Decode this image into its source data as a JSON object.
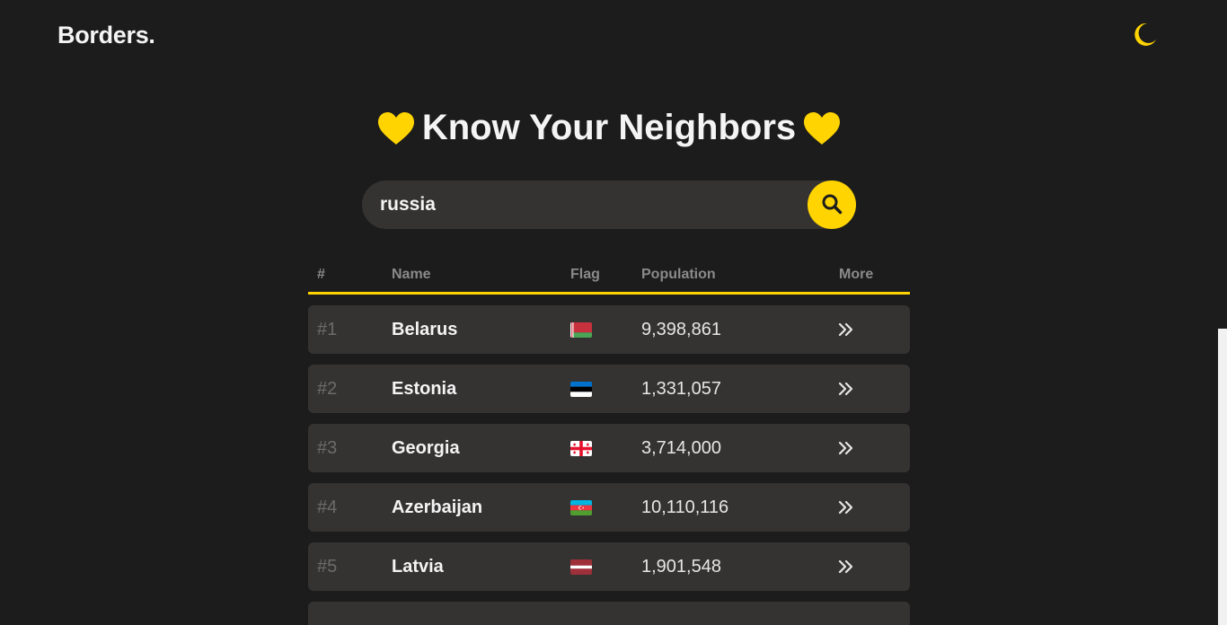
{
  "header": {
    "logo": "Borders.",
    "theme_toggle_icon": "crescent-moon-icon"
  },
  "hero": {
    "title": "Know Your Neighbors",
    "icon": "yellow-heart-icon"
  },
  "search": {
    "value": "russia",
    "button_icon": "search-icon"
  },
  "table": {
    "headers": {
      "rank": "#",
      "name": "Name",
      "flag": "Flag",
      "population": "Population",
      "more": "More"
    },
    "rows": [
      {
        "rank": "#1",
        "name": "Belarus",
        "flag": "belarus-flag-icon",
        "population": "9,398,861"
      },
      {
        "rank": "#2",
        "name": "Estonia",
        "flag": "estonia-flag-icon",
        "population": "1,331,057"
      },
      {
        "rank": "#3",
        "name": "Georgia",
        "flag": "georgia-flag-icon",
        "population": "3,714,000"
      },
      {
        "rank": "#4",
        "name": "Azerbaijan",
        "flag": "azerbaijan-flag-icon",
        "population": "10,110,116"
      },
      {
        "rank": "#5",
        "name": "Latvia",
        "flag": "latvia-flag-icon",
        "population": "1,901,548"
      }
    ],
    "more_icon": "double-chevron-right-icon"
  },
  "colors": {
    "background": "#1c1c1c",
    "accent": "#ffd400",
    "surface": "#353332"
  }
}
